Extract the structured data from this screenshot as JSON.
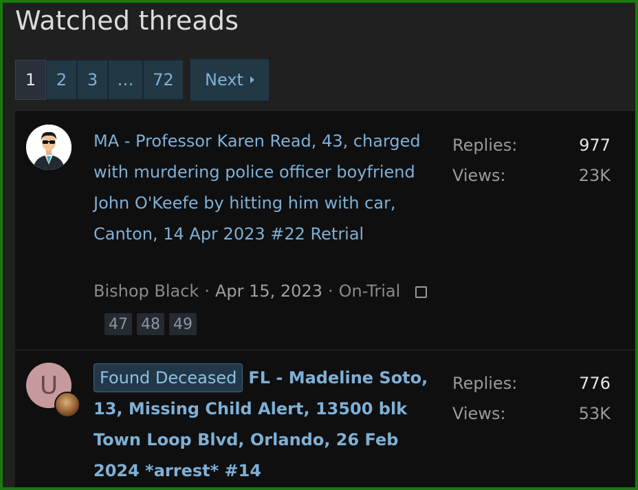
{
  "page": {
    "title": "Watched threads"
  },
  "pagination": {
    "pages": [
      "1",
      "2",
      "3",
      "…",
      "72"
    ],
    "current": "1",
    "next_label": "Next"
  },
  "threads": [
    {
      "prefix": "",
      "title": "MA - Professor Karen Read, 43, charged with murdering police officer boyfriend John O'Keefe by hitting him with car, Canton, 14 Apr 2023 #22 Retrial",
      "author": "Bishop Black",
      "date": "Apr 15, 2023",
      "forum": "On-Trial",
      "pages": [
        "47",
        "48",
        "49"
      ],
      "replies_label": "Replies:",
      "replies": "977",
      "views_label": "Views:",
      "views": "23K"
    },
    {
      "prefix": "Found Deceased",
      "avatar_letter": "U",
      "title": "FL - Madeline Soto, 13, Missing Child Alert, 13500 blk Town Loop Blvd, Orlando, 26 Feb 2024 *arrest* #14",
      "replies_label": "Replies:",
      "replies": "776",
      "views_label": "Views:",
      "views": "53K"
    }
  ],
  "icons": {
    "next": "chevron-right-icon",
    "watch_checkbox": "checkbox-icon"
  },
  "colors": {
    "link": "#7eb0d6",
    "frame_border": "#1a7a0f",
    "background": "#202020",
    "list_background": "#0f0f10"
  }
}
